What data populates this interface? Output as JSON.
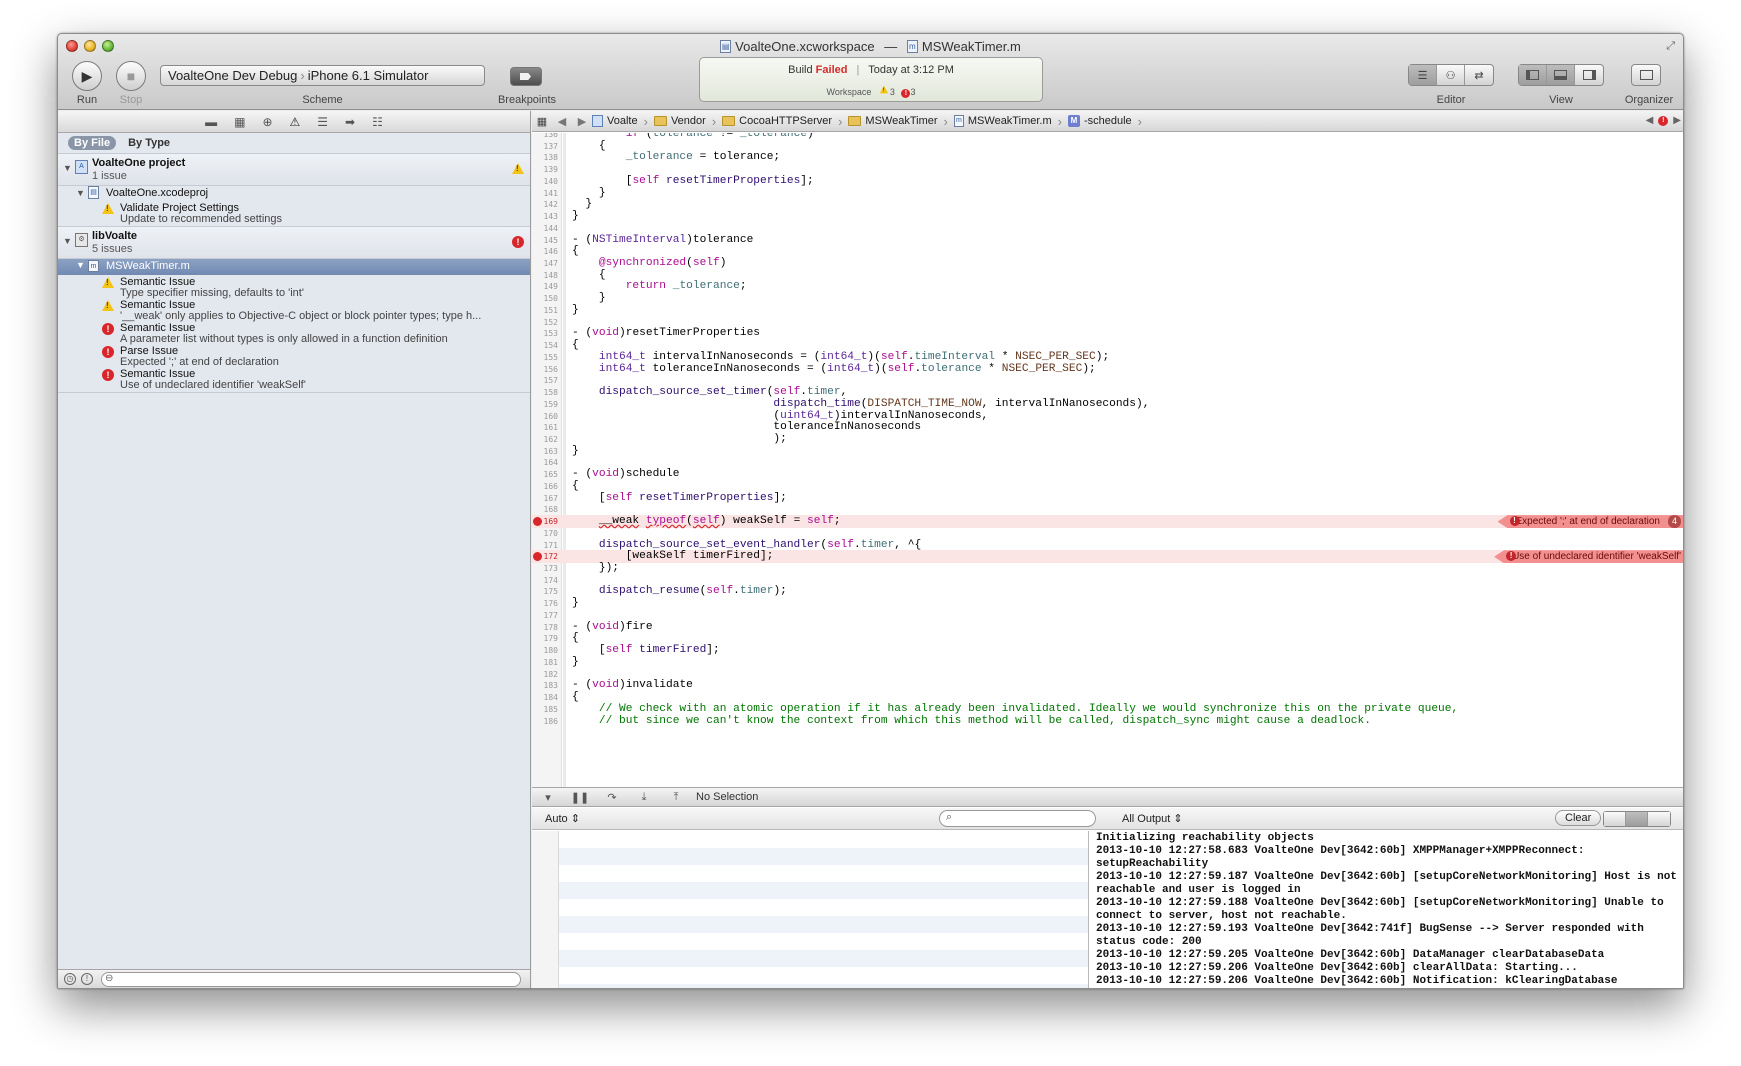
{
  "window": {
    "workspace_name": "VoalteOne.xcworkspace",
    "title_sep": "—",
    "file_name": "MSWeakTimer.m"
  },
  "toolbar": {
    "run_label": "Run",
    "stop_label": "Stop",
    "scheme_target": "VoalteOne Dev Debug",
    "scheme_device": "iPhone 6.1 Simulator",
    "scheme_label": "Scheme",
    "breakpoints_label": "Breakpoints",
    "editor_label": "Editor",
    "view_label": "View",
    "organizer_label": "Organizer"
  },
  "activity": {
    "build": "Build",
    "status": "Failed",
    "sep": "|",
    "time": "Today at 3:12 PM",
    "workspace_label": "Workspace",
    "warnings": "3",
    "errors": "3"
  },
  "navigator": {
    "scope_by_file": "By File",
    "scope_by_type": "By Type",
    "groups": [
      {
        "title": "VoalteOne project",
        "subtitle": "1 issue",
        "file": "VoalteOne.xcodeproj",
        "issues": [
          {
            "kind": "warning",
            "title": "Validate Project Settings",
            "detail": "Update to recommended settings"
          }
        ]
      },
      {
        "title": "libVoalte",
        "subtitle": "5 issues",
        "file": "MSWeakTimer.m",
        "issues": [
          {
            "kind": "warning",
            "title": "Semantic Issue",
            "detail": "Type specifier missing, defaults to 'int'"
          },
          {
            "kind": "warning",
            "title": "Semantic Issue",
            "detail": "'__weak' only applies to Objective-C object or block pointer types; type h..."
          },
          {
            "kind": "error",
            "title": "Semantic Issue",
            "detail": "A parameter list without types is only allowed in a function definition"
          },
          {
            "kind": "error",
            "title": "Parse Issue",
            "detail": "Expected ';' at end of declaration"
          },
          {
            "kind": "error",
            "title": "Semantic Issue",
            "detail": "Use of undeclared identifier 'weakSelf'"
          }
        ]
      }
    ]
  },
  "jumpbar": {
    "crumbs": [
      "Voalte",
      "Vendor",
      "CocoaHTTPServer",
      "MSWeakTimer",
      "MSWeakTimer.m",
      "-schedule"
    ]
  },
  "editor": {
    "annotations": {
      "line169": "Expected ';' at end of declaration",
      "line169_count": "4",
      "line172": "Use of undeclared identifier 'weakSelf'"
    }
  },
  "debug": {
    "debugbar_selection": "No Selection",
    "vars_scope": "Auto",
    "output_scope": "All Output",
    "clear_label": "Clear",
    "console_lines": [
      "Initializing reachability objects",
      "2013-10-10 12:27:58.683 VoalteOne Dev[3642:60b] XMPPManager+XMPPReconnect: setupReachability",
      "2013-10-10 12:27:59.187 VoalteOne Dev[3642:60b] [setupCoreNetworkMonitoring] Host is not reachable and user is logged in",
      "2013-10-10 12:27:59.188 VoalteOne Dev[3642:60b] [setupCoreNetworkMonitoring] Unable to connect to server, host not reachable.",
      "2013-10-10 12:27:59.193 VoalteOne Dev[3642:741f] BugSense --> Server responded with status code: 200",
      "2013-10-10 12:27:59.205 VoalteOne Dev[3642:60b] DataManager clearDatabaseData",
      "2013-10-10 12:27:59.206 VoalteOne Dev[3642:60b] clearAllData: Starting...",
      "2013-10-10 12:27:59.206 VoalteOne Dev[3642:60b] Notification: kClearingDatabase"
    ]
  },
  "colors": {
    "error": "#d8262b",
    "warning": "#f3c316",
    "keyword": "#aa0d91",
    "comment": "#007400",
    "selection": "#7189b2"
  }
}
